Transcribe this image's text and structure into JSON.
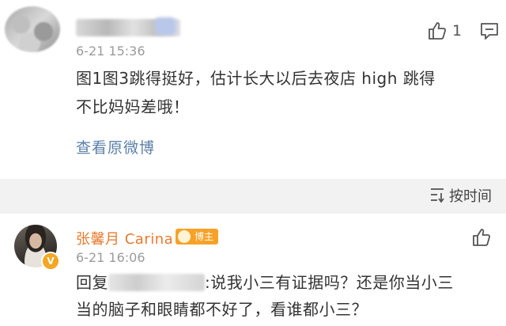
{
  "comment1": {
    "timestamp": "6-21 15:36",
    "text_line1": "图1图3跳得挺好，估计长大以后去夜店 high 跳得",
    "text_line2": "不比妈妈差哦！",
    "view_original": "查看原微博",
    "like_count": "1",
    "like_icon": "thumbs-up-icon",
    "reply_icon": "comment-icon"
  },
  "sort": {
    "label": "按时间",
    "icon": "sort-icon"
  },
  "comment2": {
    "username": "张馨月 Carina",
    "badge": "博主",
    "verified": "V",
    "timestamp": "6-21 16:06",
    "reply_prefix": "回复",
    "reply_text1": ":说我小三有证据吗？还是你当小三",
    "reply_text2": "当的脑子和眼睛都不好了，看谁都小三？",
    "like_icon": "thumbs-up-icon"
  },
  "colors": {
    "username": "#e87a2e",
    "link": "#5b7fa9",
    "badge": "#f7a227",
    "sort_bar_bg": "#f2f2f2"
  }
}
